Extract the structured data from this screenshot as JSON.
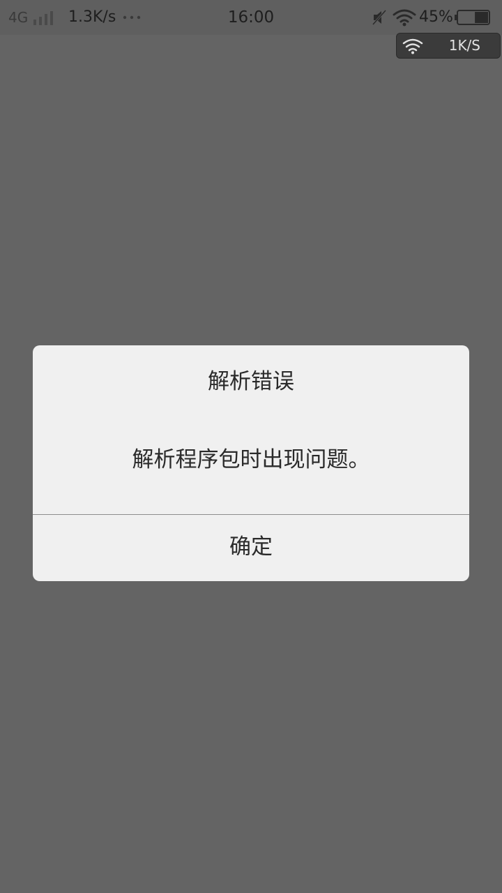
{
  "status_bar": {
    "network_type": "4G",
    "net_speed": "1.3K/s",
    "time": "16:00",
    "battery_percent": "45%",
    "battery_level": 0.45,
    "icons": [
      "signal-icon",
      "more-dots-icon",
      "mute-icon",
      "wifi-icon",
      "battery-icon"
    ]
  },
  "speed_overlay": {
    "speed": "1K/S",
    "icon": "wifi-icon"
  },
  "dialog": {
    "title": "解析错误",
    "message": "解析程序包时出现问题。",
    "confirm_label": "确定"
  },
  "colors": {
    "background": "#646464",
    "dialog_bg": "#f0f0f0",
    "text": "#2a2a2a"
  }
}
